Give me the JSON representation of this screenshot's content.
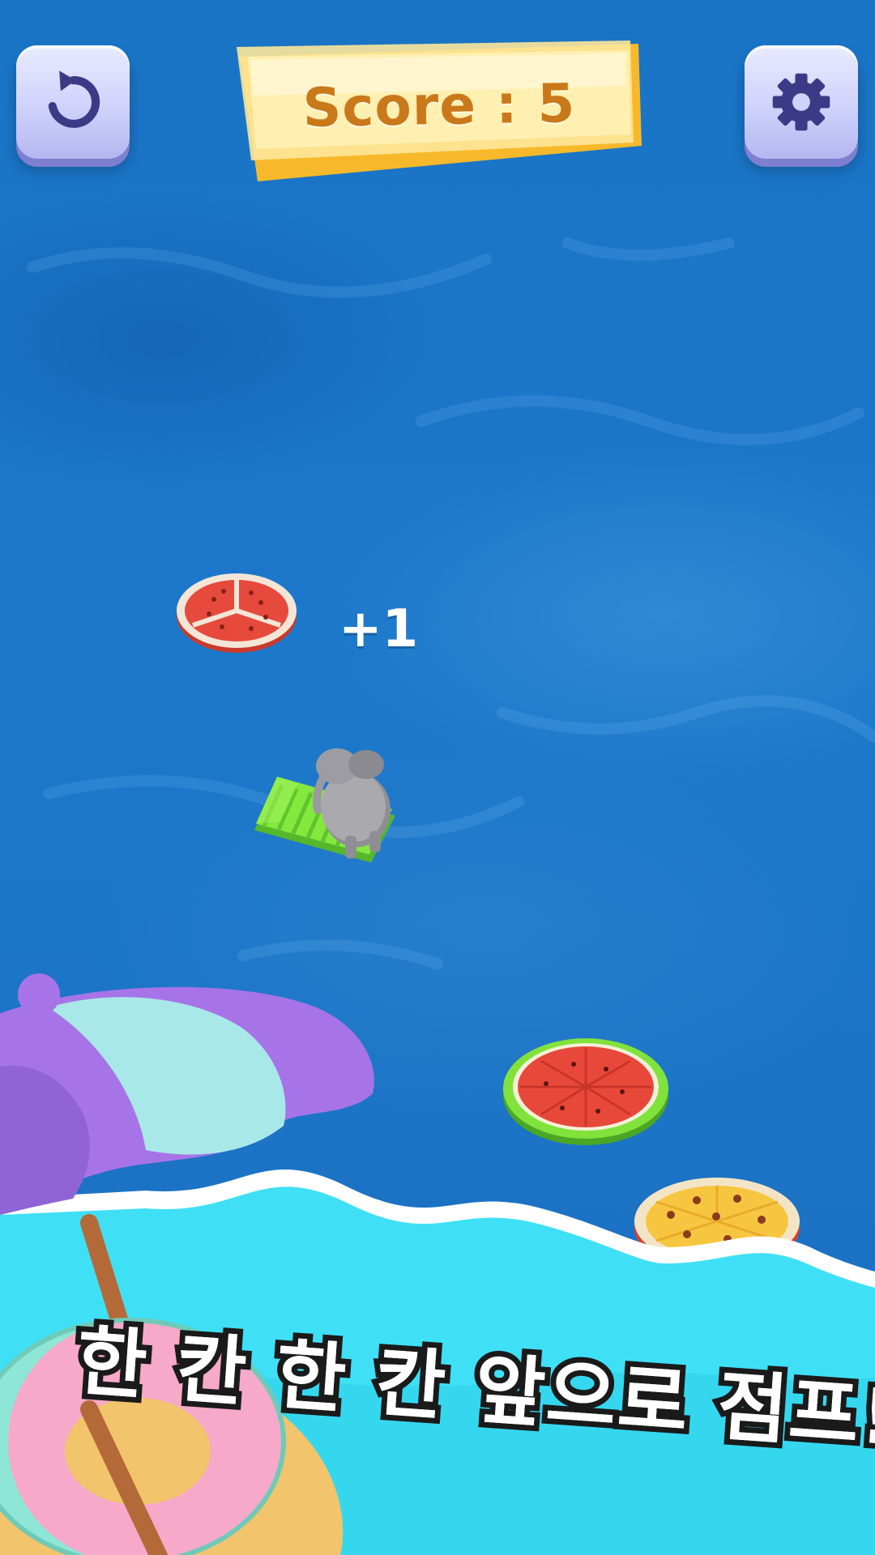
{
  "hud": {
    "score_label": "Score : 5",
    "restart_icon": "restart-icon",
    "settings_icon": "gear-icon"
  },
  "popup": {
    "score_gain": "+1"
  },
  "platforms": [
    {
      "kind": "watermelon-slice",
      "color": "#e64a3c"
    },
    {
      "kind": "sun-lounger",
      "color": "#7be23a"
    },
    {
      "kind": "watermelon-ring",
      "color": "#e8483a"
    },
    {
      "kind": "pizza",
      "color": "#f7c640"
    }
  ],
  "player": {
    "kind": "elephant",
    "color": "#9c9ca2"
  },
  "caption": "한 칸 한 칸 앞으로 점프!",
  "colors": {
    "water": "#1c76c8",
    "wave": "#3fe0f5",
    "umbrella_purple": "#a774e8",
    "umbrella_teal": "#a9e8e8",
    "float_pink": "#f7a9c9",
    "score_text": "#c9781a"
  }
}
